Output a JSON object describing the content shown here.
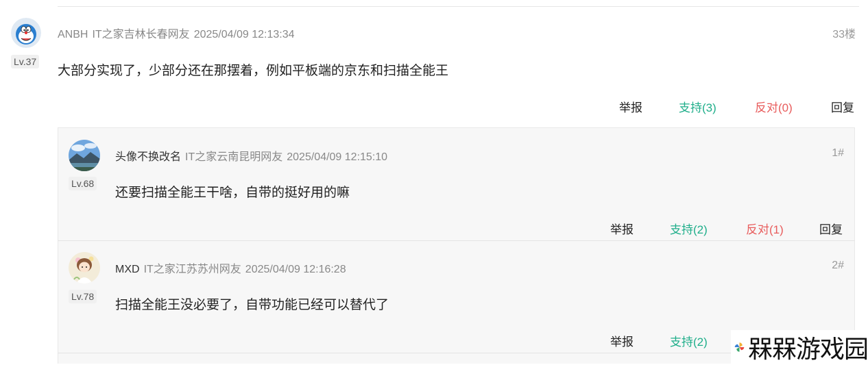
{
  "main_comment": {
    "user": "ANBH",
    "location": "IT之家吉林长春网友",
    "time": "2025/04/09 12:13:34",
    "floor": "33楼",
    "level": "Lv.37",
    "content": "大部分实现了，少部分还在那摆着，例如平板端的京东和扫描全能王",
    "actions": {
      "report": "举报",
      "support": "支持(3)",
      "oppose": "反对(0)",
      "reply": "回复"
    }
  },
  "replies": [
    {
      "user": "头像不换改名",
      "location": "IT之家云南昆明网友",
      "time": "2025/04/09 12:15:10",
      "floor": "1#",
      "level": "Lv.68",
      "content": "还要扫描全能王干啥，自带的挺好用的嘛",
      "actions": {
        "report": "举报",
        "support": "支持(2)",
        "oppose": "反对(1)",
        "reply": "回复"
      }
    },
    {
      "user": "MXD",
      "location": "IT之家江苏苏州网友",
      "time": "2025/04/09 12:16:28",
      "floor": "2#",
      "level": "Lv.78",
      "content": "扫描全能王没必要了，自带功能已经可以替代了",
      "actions": {
        "report": "举报",
        "support": "支持(2)"
      }
    }
  ],
  "watermark": {
    "text": "槑槑游戏园"
  },
  "colors": {
    "support": "#1fae8a",
    "oppose": "#e85c5c",
    "meta": "#888888"
  }
}
